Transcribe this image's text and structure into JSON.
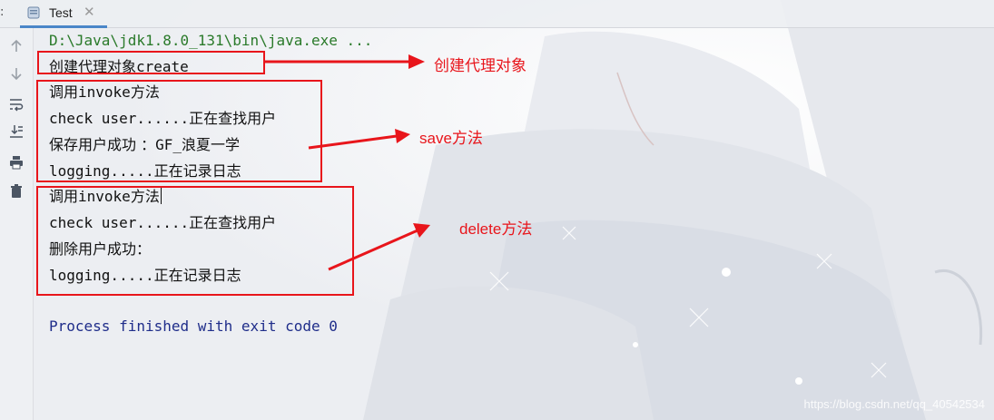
{
  "tabs": {
    "prefix": ":",
    "active": {
      "label": "Test",
      "close": "✕"
    }
  },
  "toolbar": {
    "icons": [
      "up-arrow-icon",
      "down-arrow-icon",
      "soft-wrap-icon",
      "scroll-to-end-icon",
      "print-icon",
      "trash-icon"
    ]
  },
  "console": {
    "command": "D:\\Java\\jdk1.8.0_131\\bin\\java.exe ...",
    "create_line_cn": "创建代理对象",
    "create_line_en": "create",
    "block1": {
      "invoke_cn1": "调用",
      "invoke_en": "invoke",
      "invoke_cn2": "方法",
      "check_en": "check user......",
      "check_cn": "正在查找用户",
      "save_cn": "保存用户成功 ：",
      "save_en": "GF_",
      "save_cn2": "浪夏一学",
      "log_en": "logging.....",
      "log_cn": "正在记录日志"
    },
    "block2": {
      "invoke_cn1": "调用",
      "invoke_en": "invoke",
      "invoke_cn2": "方法",
      "check_en": "check user......",
      "check_cn": "正在查找用户",
      "delete_cn": "删除用户成功：",
      "log_en": "logging.....",
      "log_cn": "正在记录日志"
    },
    "exit_line": "Process finished with exit code 0"
  },
  "annotations": {
    "create_label": "创建代理对象",
    "save_label": "save方法",
    "delete_label": "delete方法",
    "color": "#e8151b"
  },
  "watermark": "https://blog.csdn.net/qq_40542534"
}
